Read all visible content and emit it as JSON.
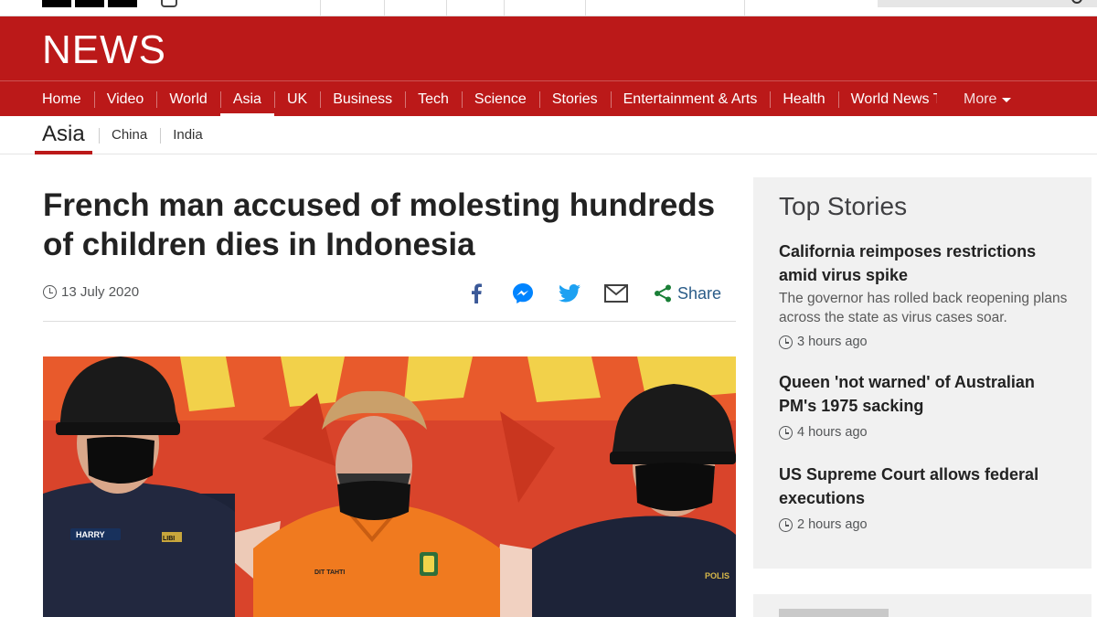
{
  "header": {
    "logo": "NEWS",
    "nav": [
      "Home",
      "Video",
      "World",
      "Asia",
      "UK",
      "Business",
      "Tech",
      "Science",
      "Stories",
      "Entertainment & Arts",
      "Health",
      "World News TV"
    ],
    "active_nav": "Asia",
    "more_label": "More"
  },
  "subnav": {
    "title": "Asia",
    "items": [
      "China",
      "India"
    ]
  },
  "article": {
    "headline": "French man accused of molesting hundreds of children dies in Indonesia",
    "date": "13 July 2020",
    "share_label": "Share",
    "share_icons": [
      "facebook-icon",
      "messenger-icon",
      "twitter-icon",
      "email-icon",
      "share-icon"
    ]
  },
  "photo": {
    "badge_left": "HARRY",
    "badge_left2": "LIBI",
    "badge_center": "DIT TAHTI",
    "badge_right": "POLIS"
  },
  "top_stories": {
    "title": "Top Stories",
    "items": [
      {
        "title": "California reimposes restrictions amid virus spike",
        "summary": "The governor has rolled back reopening plans across the state as virus cases soar.",
        "time": "3 hours ago"
      },
      {
        "title": "Queen 'not warned' of Australian PM's 1975 sacking",
        "time": "4 hours ago"
      },
      {
        "title": "US Supreme Court allows federal executions",
        "time": "2 hours ago"
      }
    ]
  },
  "colors": {
    "brand_red": "#bb1919",
    "link_blue": "#2a5c88",
    "sidebar_bg": "#f1f1f1"
  }
}
